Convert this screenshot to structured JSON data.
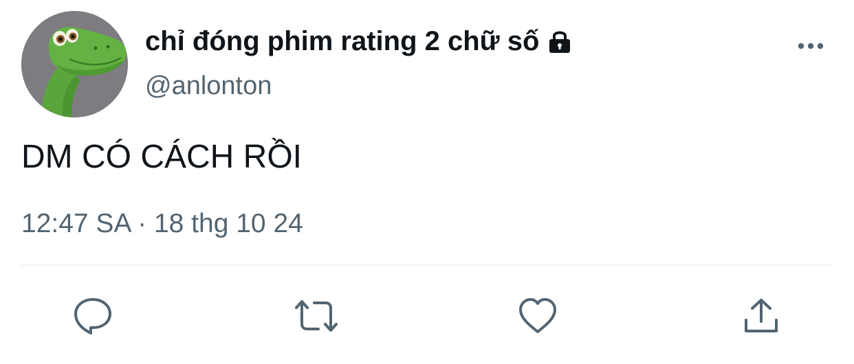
{
  "author": {
    "display_name": "chỉ đóng phim rating 2 chữ số",
    "handle": "@anlonton",
    "protected_icon": "lock-icon",
    "avatar": "green-dinosaur-avatar"
  },
  "tweet": {
    "text": "DM CÓ CÁCH RỒI",
    "timestamp": "12:47 SA · 18 thg 10 24"
  },
  "actions": {
    "reply": "reply-icon",
    "retweet": "retweet-icon",
    "like": "heart-icon",
    "share": "share-icon"
  },
  "colors": {
    "text_primary": "#0f1419",
    "text_secondary": "#536471",
    "divider": "#eff3f4"
  }
}
